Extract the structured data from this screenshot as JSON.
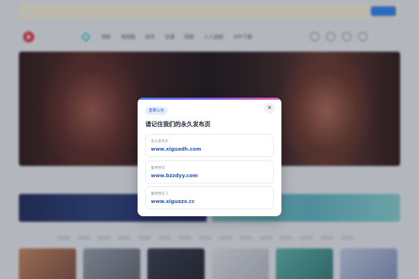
{
  "background": {
    "nav": {
      "items": [
        "电影",
        "电视剧",
        "综艺",
        "动漫",
        "短剧",
        "人人追剧",
        "APP下载"
      ]
    }
  },
  "modal": {
    "badge": "重要公告",
    "close_glyph": "✕",
    "title": "请记住我们的永久发布页",
    "addresses": [
      {
        "label": "永久发布页",
        "url": "www.xiguadh.com"
      },
      {
        "label": "备用地址",
        "url": "www.bzzdyy.com"
      },
      {
        "label": "备用地址 2",
        "url": "www.xiguazx.cc"
      }
    ]
  },
  "colors": {
    "accent": "#2758c4",
    "brand_red": "#e23a4a",
    "badge_bg": "#e7efff"
  }
}
